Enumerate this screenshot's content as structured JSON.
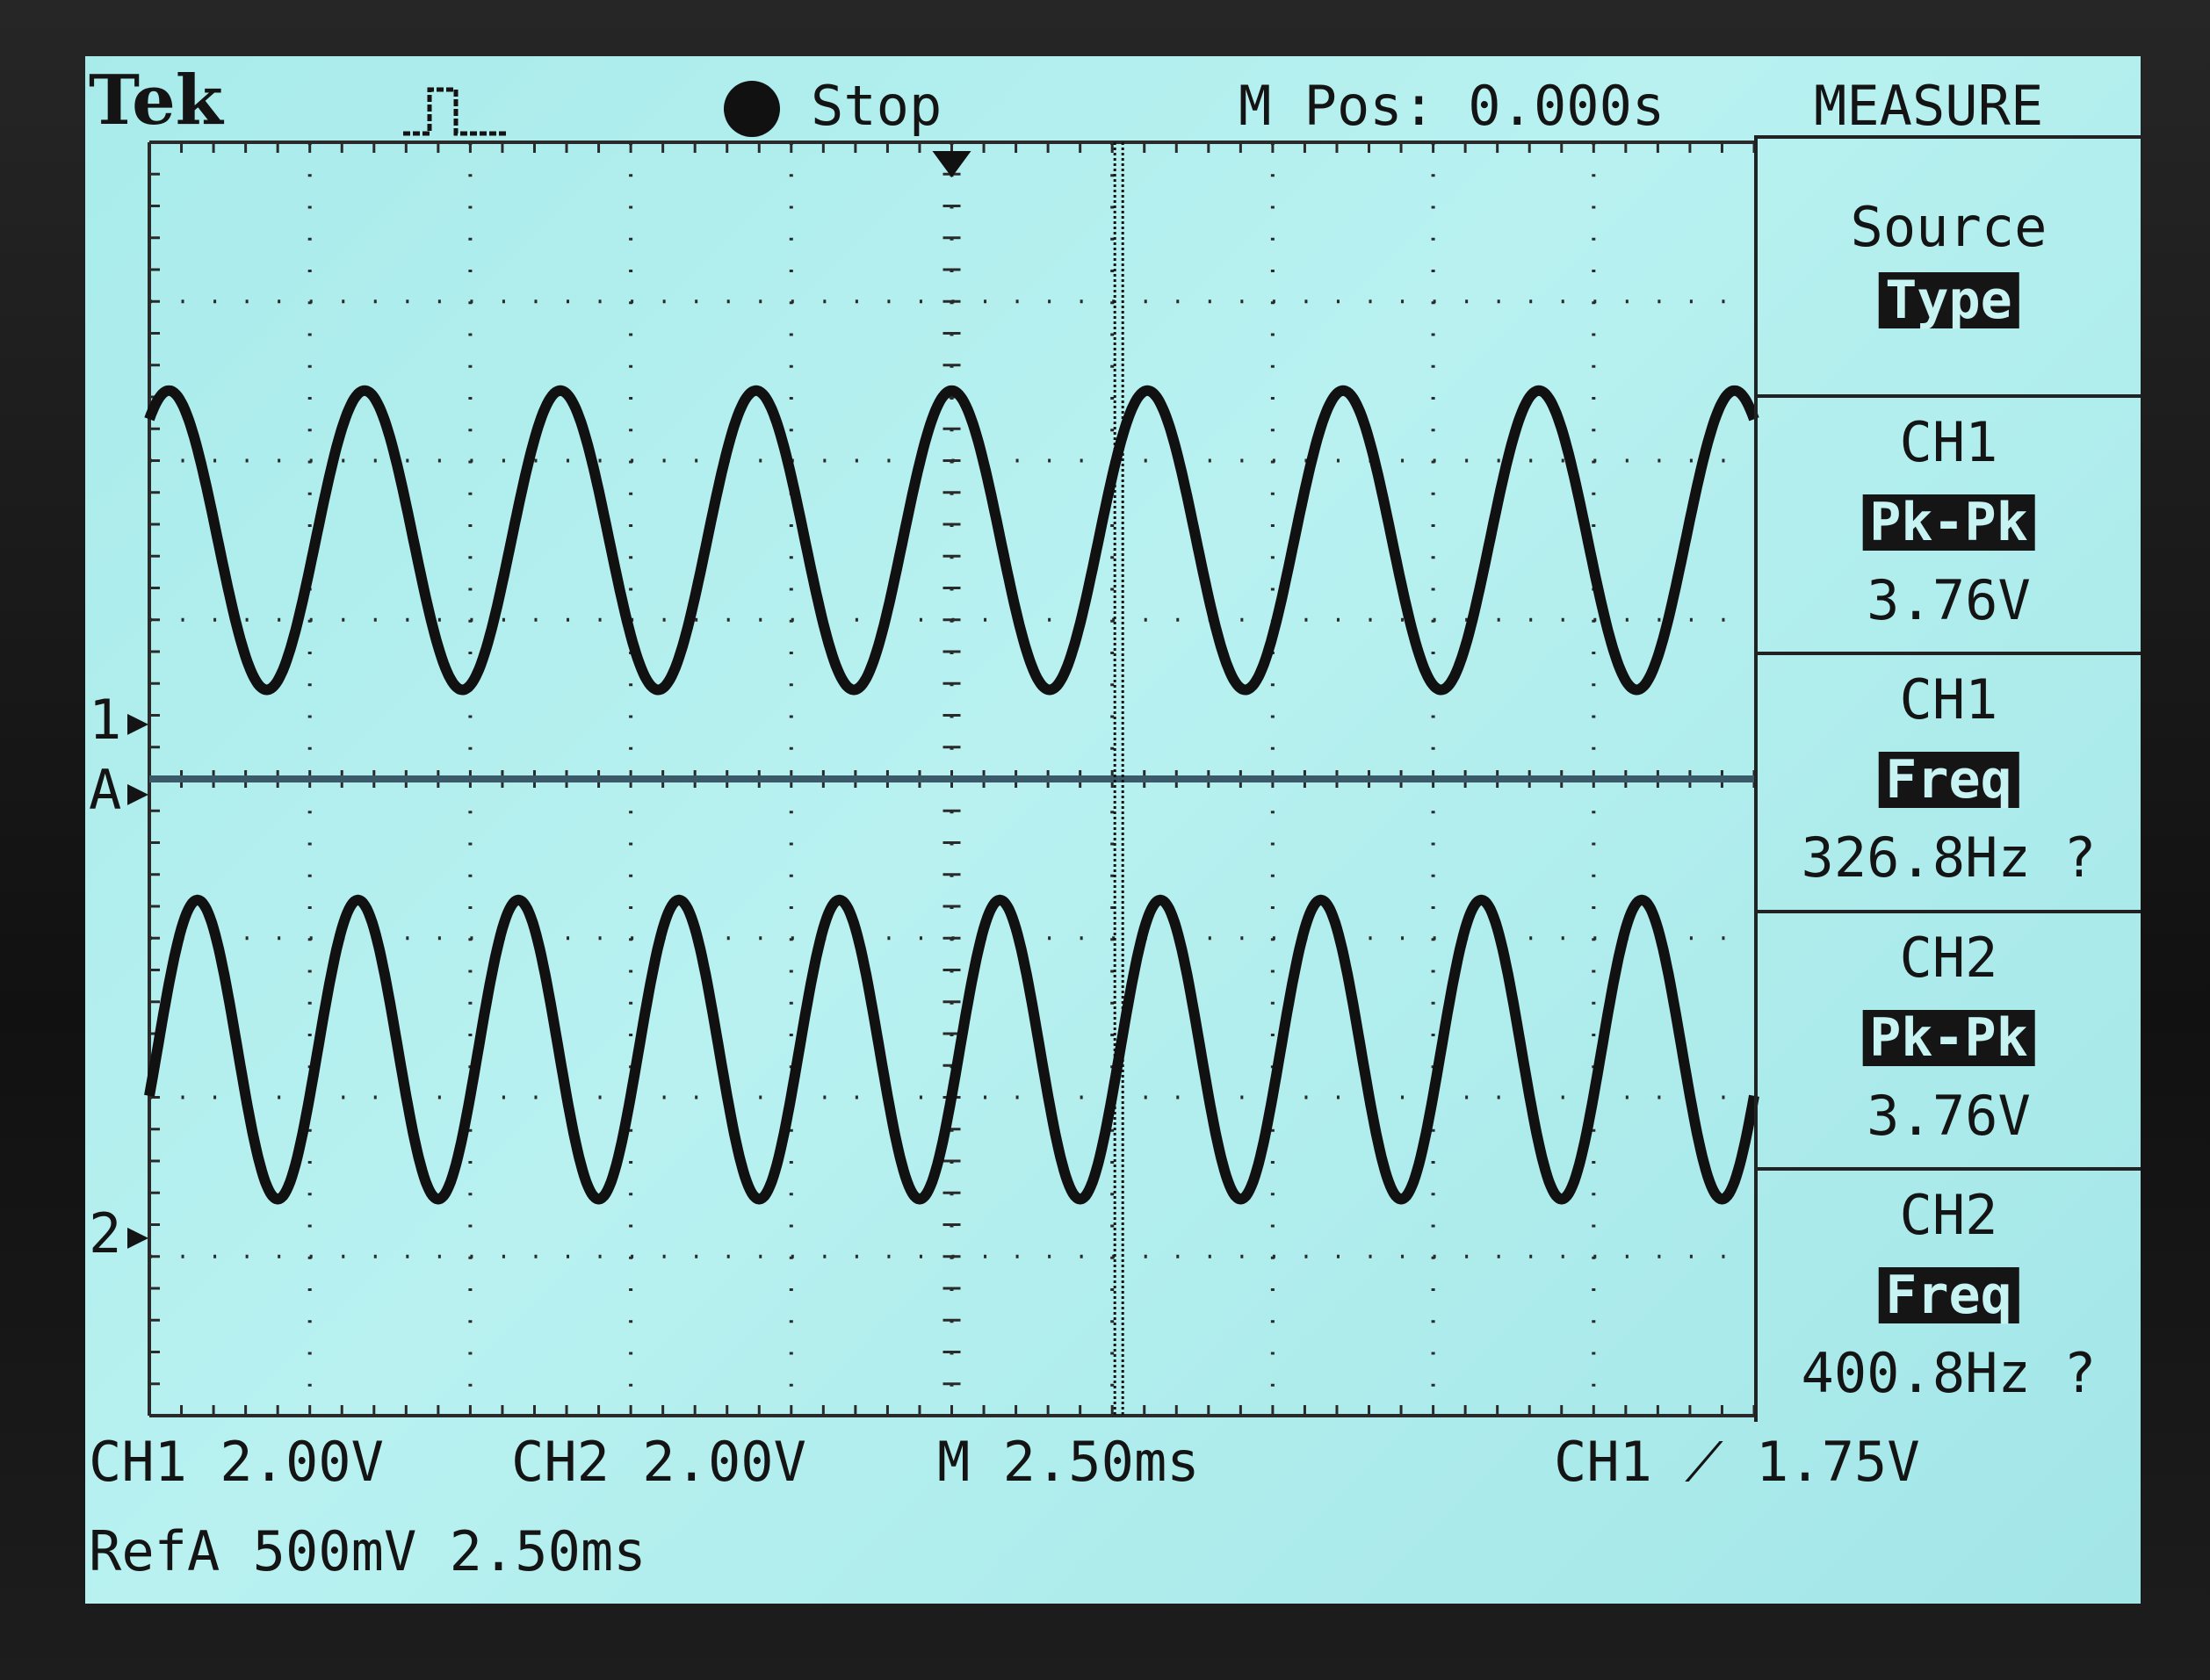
{
  "header": {
    "brand": "Tek",
    "run_state": "Stop",
    "m_pos": "M Pos: 0.000s",
    "menu_title": "MEASURE"
  },
  "markers": {
    "ch1": "1",
    "ref_a": "A",
    "ch2": "2"
  },
  "side_menu": [
    {
      "title": "Source",
      "highlight": "Type",
      "value": ""
    },
    {
      "title": "CH1",
      "highlight": "Pk-Pk",
      "value": "3.76V"
    },
    {
      "title": "CH1",
      "highlight": "Freq",
      "value": "326.8Hz ?"
    },
    {
      "title": "CH2",
      "highlight": "Pk-Pk",
      "value": "3.76V"
    },
    {
      "title": "CH2",
      "highlight": "Freq",
      "value": "400.8Hz ?"
    }
  ],
  "status": {
    "ch1_scale": "CH1  2.00V",
    "ch2_scale": "CH2  2.00V",
    "timebase": "M 2.50ms",
    "trigger": "CH1 ⟋ 1.75V",
    "ref": "RefA 500mV 2.50ms"
  },
  "traces": {
    "ch1": {
      "cycles": 8.2,
      "amplitude_div": 0.94,
      "center_div": 1.5,
      "phase": 0.15
    },
    "ch2": {
      "cycles": 10.0,
      "amplitude_div": 0.94,
      "center_div": -1.7,
      "phase": 0.95
    },
    "ref_a": {
      "level_div": 0.0
    }
  },
  "colors": {
    "screen": "#b4efef",
    "trace": "#111111",
    "grid": "#2a2a2a"
  }
}
